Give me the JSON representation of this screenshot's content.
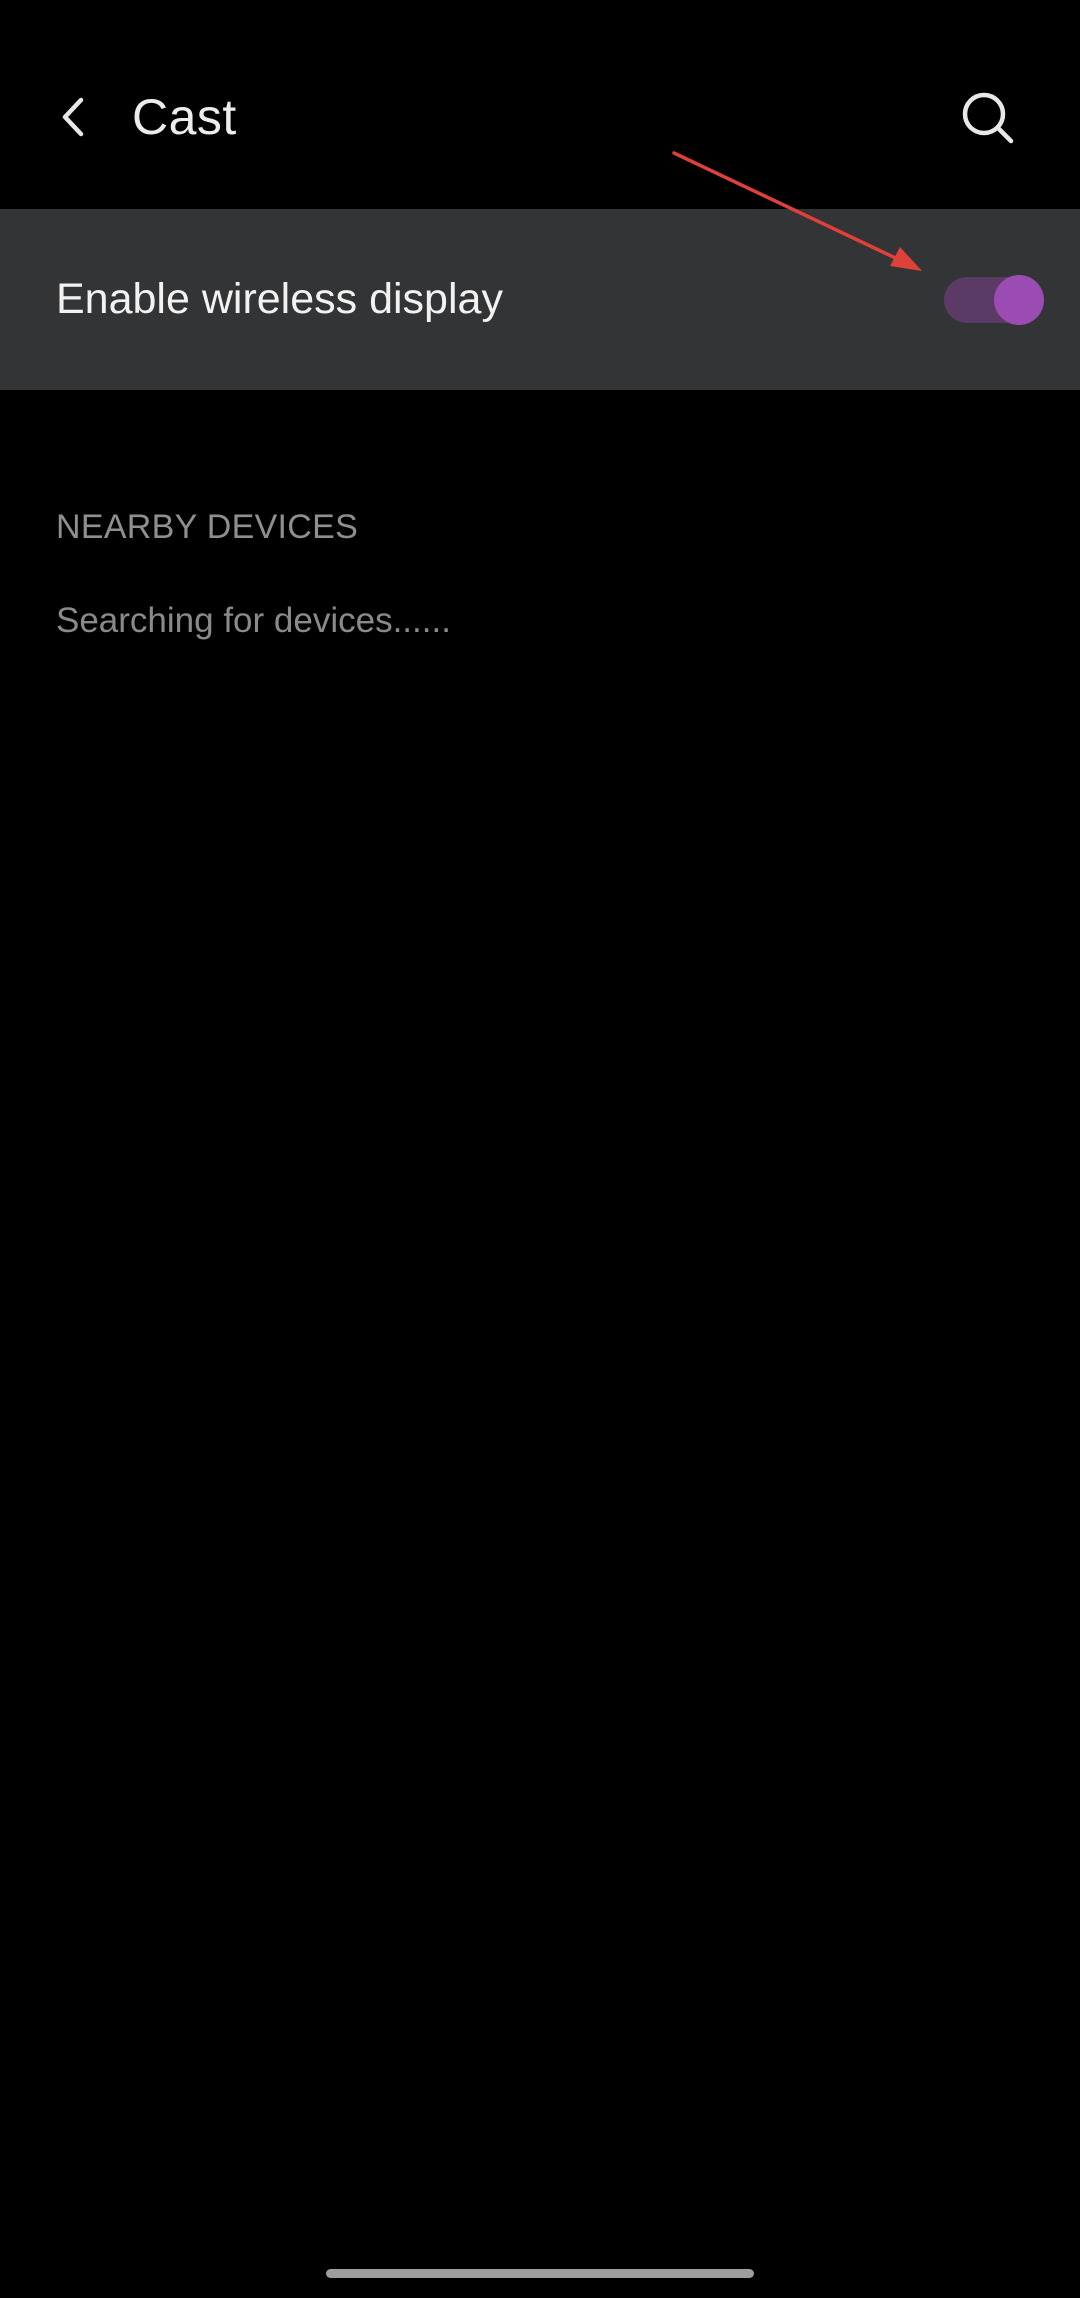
{
  "header": {
    "title": "Cast",
    "back_icon": "chevron-left-icon",
    "search_icon": "search-icon"
  },
  "settings": {
    "wireless_display": {
      "label": "Enable wireless display",
      "enabled": true,
      "track_color": "#5b3a66",
      "thumb_color": "#9b4cb3"
    }
  },
  "nearby_devices": {
    "header": "NEARBY DEVICES",
    "status": "Searching for devices......"
  },
  "annotation": {
    "arrow_color": "#e0403a"
  },
  "colors": {
    "background": "#000000",
    "row_background": "#333436"
  }
}
